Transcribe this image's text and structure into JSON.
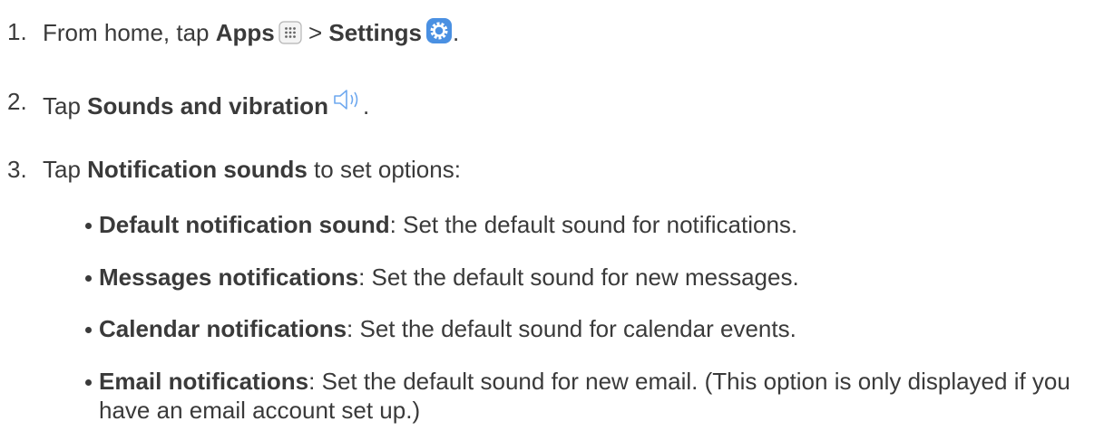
{
  "steps": [
    {
      "number": "1.",
      "lead": "From home, tap ",
      "apps_label": "Apps",
      "separator": " > ",
      "settings_label": "Settings",
      "end": ".",
      "icons": [
        "apps-grid-icon",
        "settings-gear-icon"
      ]
    },
    {
      "number": "2.",
      "lead": "Tap ",
      "sounds_label": "Sounds and vibration",
      "end": ".",
      "icons": [
        "speaker-icon"
      ]
    },
    {
      "number": "3.",
      "lead": "Tap ",
      "notif_label": "Notification sounds",
      "tail": " to set options:"
    }
  ],
  "options": [
    {
      "title": "Default notification sound",
      "desc": ": Set the default sound for notifications."
    },
    {
      "title": "Messages notifications",
      "desc": ": Set the default sound for new messages."
    },
    {
      "title": "Calendar notifications",
      "desc": ": Set the default sound for calendar events."
    },
    {
      "title": "Email notifications",
      "desc": ": Set the default sound for new email. (This option is only displayed if you have an email account set up.)"
    }
  ],
  "colors": {
    "text": "#3a3a3a",
    "settings_icon": "#4a90e2",
    "speaker_icon": "#6ea8ef"
  }
}
